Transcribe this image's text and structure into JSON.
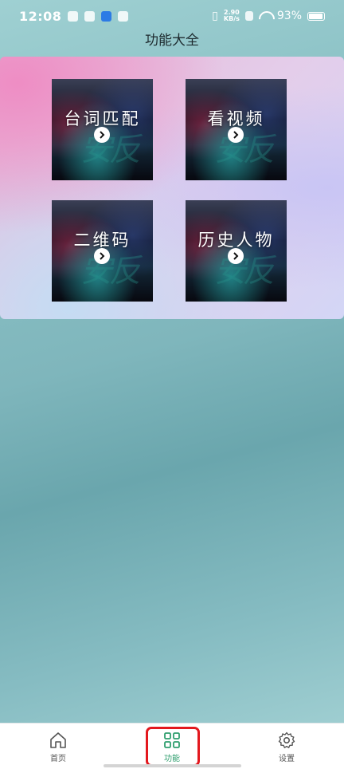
{
  "status_bar": {
    "time": "12:08",
    "net_speed_value": "2.90",
    "net_speed_unit": "KB/s",
    "battery": "93%"
  },
  "page": {
    "title": "功能大全"
  },
  "cards": [
    {
      "label": "台词匹配",
      "watermark": "安反"
    },
    {
      "label": "看视频",
      "watermark": "安反"
    },
    {
      "label": "二维码",
      "watermark": "安反"
    },
    {
      "label": "历史人物",
      "watermark": "安反"
    }
  ],
  "tabbar": {
    "home": "首页",
    "functions": "功能",
    "settings": "设置"
  },
  "colors": {
    "active_tab": "#2f9e6e",
    "highlight_box": "#e3181e"
  },
  "icons": {
    "home": "home-icon",
    "functions": "grid-icon",
    "settings": "gear-icon",
    "card_arrow": "chevron-right-circle-icon"
  }
}
